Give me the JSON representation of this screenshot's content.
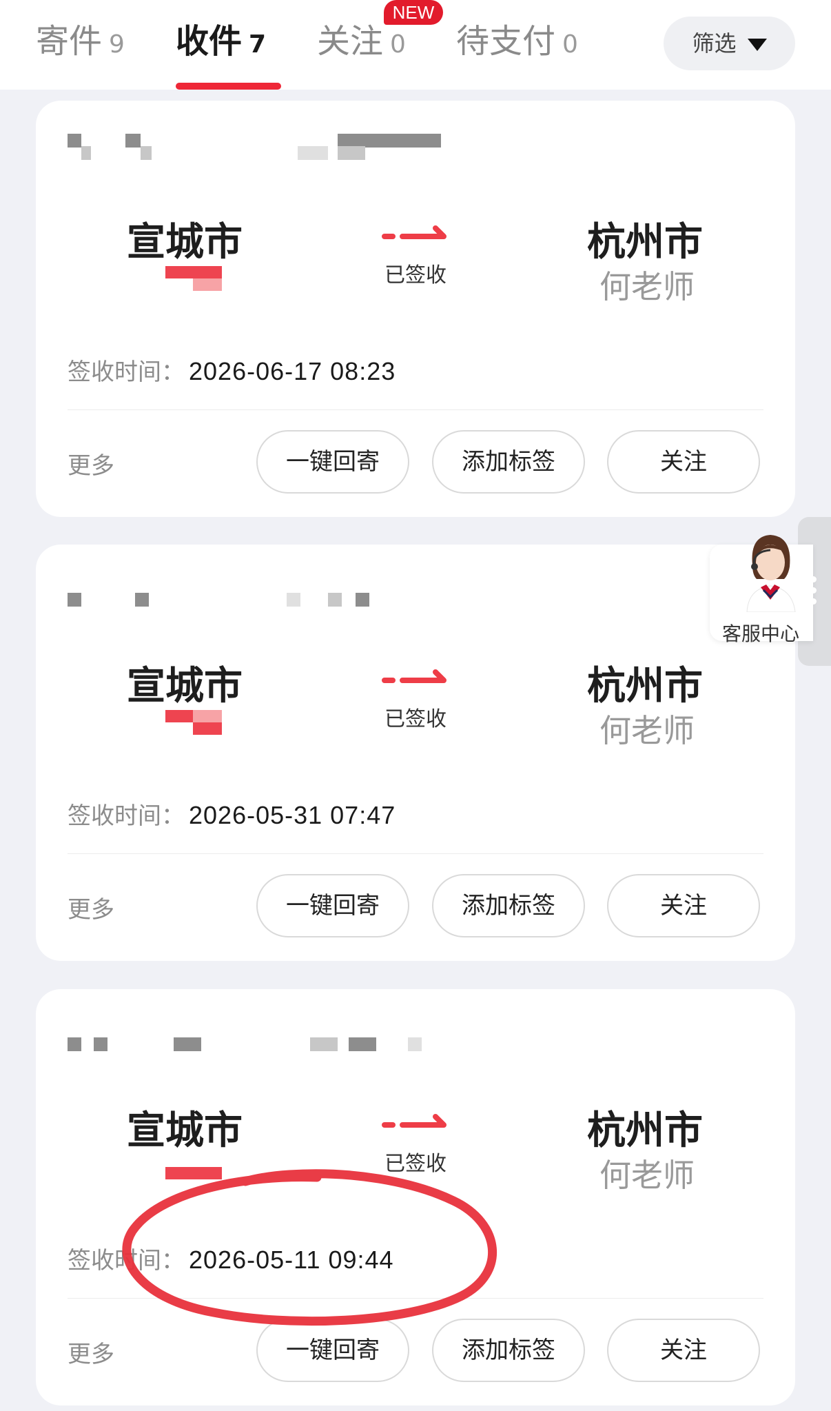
{
  "tabs": [
    {
      "label": "寄件",
      "count": "9"
    },
    {
      "label": "收件",
      "count": "7"
    },
    {
      "label": "关注",
      "count": "0"
    },
    {
      "label": "待支付",
      "count": "0"
    }
  ],
  "new_badge": "NEW",
  "filter": {
    "label": "筛选"
  },
  "cards": [
    {
      "from_city": "宣城市",
      "to_city": "杭州市",
      "to_name": "何老师",
      "status": "已签收",
      "sign_label": "签收时间：",
      "sign_time": "2026-06-17 08:23",
      "more": "更多",
      "actions": [
        "一键回寄",
        "添加标签",
        "关注"
      ]
    },
    {
      "from_city": "宣城市",
      "to_city": "杭州市",
      "to_name": "何老师",
      "status": "已签收",
      "sign_label": "签收时间：",
      "sign_time": "2026-05-31 07:47",
      "more": "更多",
      "actions": [
        "一键回寄",
        "添加标签",
        "关注"
      ]
    },
    {
      "from_city": "宣城市",
      "to_city": "杭州市",
      "to_name": "何老师",
      "status": "已签收",
      "sign_label": "签收时间：",
      "sign_time": "2026-05-11 09:44",
      "more": "更多",
      "actions": [
        "一键回寄",
        "添加标签",
        "关注"
      ]
    }
  ],
  "customer_service": {
    "label": "客服中心",
    "icon": "agent-avatar-icon"
  },
  "colors": {
    "accent": "#ee2737",
    "badge": "#e21b2c",
    "annotation": "#e8323c"
  }
}
